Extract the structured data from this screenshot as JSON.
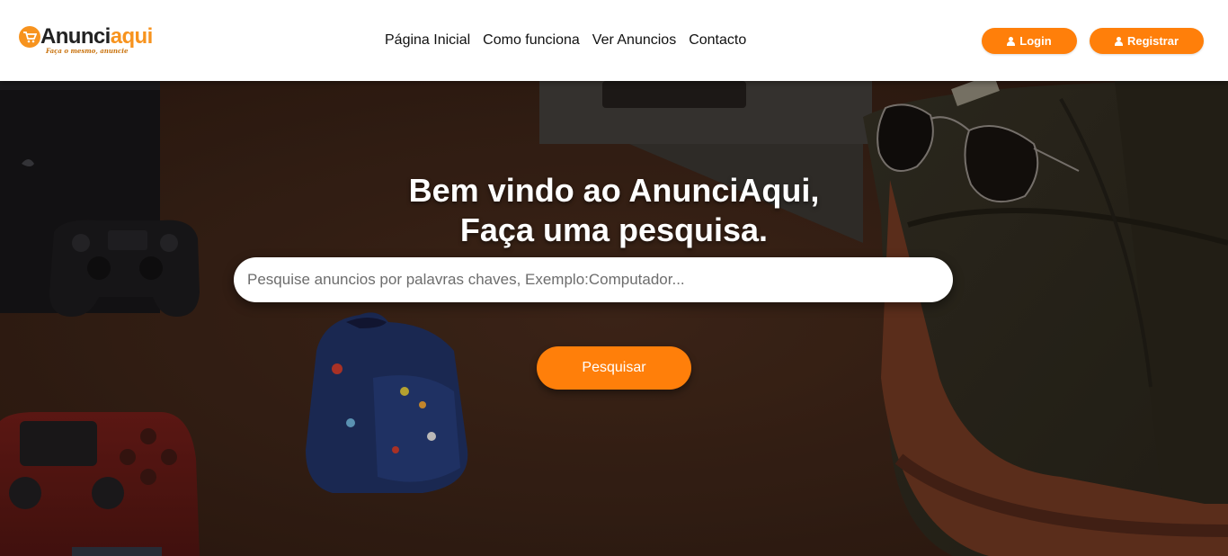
{
  "brand": {
    "name_part1": "Anunci",
    "name_part2": "aqui",
    "tagline": "Faça o mesmo, anuncie"
  },
  "nav": {
    "links": [
      {
        "label": "Página Inicial"
      },
      {
        "label": "Como funciona"
      },
      {
        "label": "Ver Anuncios"
      },
      {
        "label": "Contacto"
      }
    ]
  },
  "auth": {
    "login_label": "Login",
    "register_label": "Registrar"
  },
  "hero": {
    "title_line1": "Bem vindo ao AnunciAqui,",
    "title_line2": "Faça uma pesquisa.",
    "search_placeholder": "Pesquise anuncios por palavras chaves, Exemplo:Computador...",
    "search_button": "Pesquisar"
  },
  "colors": {
    "accent": "#ff7f0a",
    "hero_bg": "#3a2418"
  }
}
